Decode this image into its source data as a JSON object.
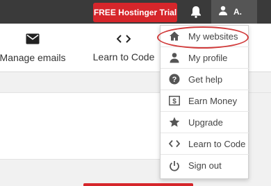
{
  "topbar": {
    "trial_button": "FREE Hostinger Trial",
    "user_initial": "A."
  },
  "nav": {
    "items": [
      {
        "label": "Manage emails",
        "icon": "envelope-icon"
      },
      {
        "label": "Learn to Code",
        "icon": "code-icon"
      }
    ]
  },
  "dropdown": {
    "items": [
      {
        "label": "My websites",
        "icon": "home-icon",
        "highlighted": true
      },
      {
        "label": "My profile",
        "icon": "person-icon"
      },
      {
        "label": "Get help",
        "icon": "help-icon"
      },
      {
        "label": "Earn Money",
        "icon": "money-icon"
      },
      {
        "label": "Upgrade",
        "icon": "star-icon"
      },
      {
        "label": "Learn to Code",
        "icon": "code-icon"
      },
      {
        "label": "Sign out",
        "icon": "power-icon"
      }
    ]
  },
  "colors": {
    "topbar": "#3a3a3a",
    "accent_red": "#d6262b",
    "highlight_oval": "#d13a3a"
  }
}
